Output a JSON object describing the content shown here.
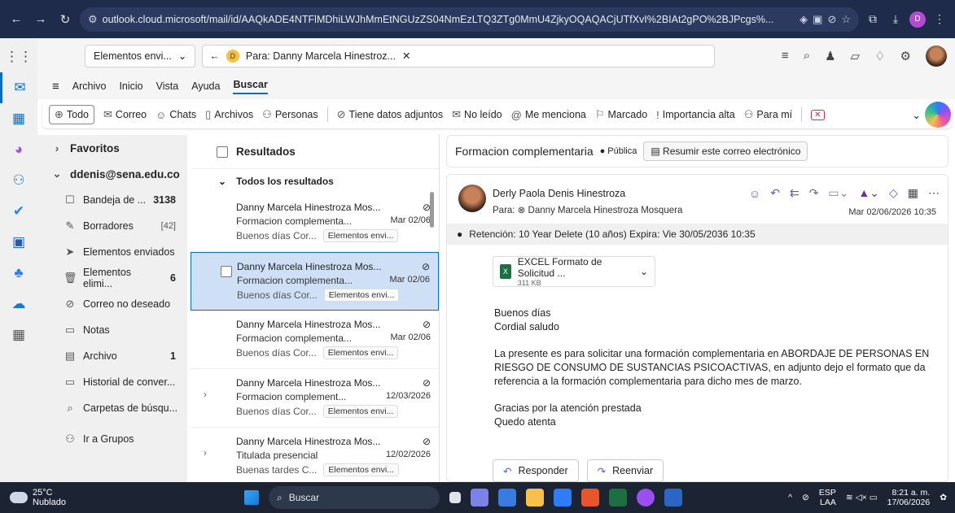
{
  "browser": {
    "url": "outlook.cloud.microsoft/mail/id/AAQkADE4NTFlMDhiLWJhMmEtNGUzZS04NmEzLTQ3ZTg0MmU4ZjkyOQAQACjUTfXvI%2BIAt2gPO%2BJPcgs%...",
    "profile_initial": "D"
  },
  "topbar": {
    "folder_pill": "Elementos envi...",
    "tab_chip_initial": "D",
    "tab_chip_label": "Para: Danny Marcela Hinestroz..."
  },
  "menu": {
    "items": [
      "Archivo",
      "Inicio",
      "Vista",
      "Ayuda"
    ],
    "active": "Buscar"
  },
  "filters": [
    {
      "icon": "⊕",
      "label": "Todo"
    },
    {
      "icon": "✉",
      "label": "Correo"
    },
    {
      "icon": "☺",
      "label": "Chats"
    },
    {
      "icon": "▯",
      "label": "Archivos"
    },
    {
      "icon": "⚇",
      "label": "Personas"
    },
    {
      "icon": "⊘",
      "label": "Tiene datos adjuntos"
    },
    {
      "icon": "✉",
      "label": "No leído"
    },
    {
      "icon": "@",
      "label": "Me menciona"
    },
    {
      "icon": "⚐",
      "label": "Marcado"
    },
    {
      "icon": "!",
      "label": "Importancia alta"
    },
    {
      "icon": "⚇",
      "label": "Para mí"
    }
  ],
  "folders": {
    "favoritos": "Favoritos",
    "account": "ddenis@sena.edu.co",
    "items": [
      {
        "icon": "☐",
        "label": "Bandeja de ...",
        "count": "3138"
      },
      {
        "icon": "✎",
        "label": "Borradores",
        "count": "[42]"
      },
      {
        "icon": "➤",
        "label": "Elementos enviados",
        "count": ""
      },
      {
        "icon": "🗑",
        "label": "Elementos elimi...",
        "count": "6"
      },
      {
        "icon": "⊘",
        "label": "Correo no deseado",
        "count": ""
      },
      {
        "icon": "▭",
        "label": "Notas",
        "count": ""
      },
      {
        "icon": "▤",
        "label": "Archivo",
        "count": "1"
      },
      {
        "icon": "▭",
        "label": "Historial de conver...",
        "count": ""
      },
      {
        "icon": "⌕",
        "label": "Carpetas de búsqu...",
        "count": ""
      }
    ],
    "groups": "Ir a Grupos"
  },
  "list": {
    "header": "Resultados",
    "group": "Todos los resultados",
    "rows": [
      {
        "from": "Danny Marcela Hinestroza Mos...",
        "subject": "Formacion complementa...",
        "date": "Mar 02/06",
        "preview": "Buenos días Cor...",
        "tag": "Elementos envi..."
      },
      {
        "from": "Danny Marcela Hinestroza Mos...",
        "subject": "Formacion complementa...",
        "date": "Mar 02/06",
        "preview": "Buenos días Cor...",
        "tag": "Elementos envi..."
      },
      {
        "from": "Danny Marcela Hinestroza Mos...",
        "subject": "Formacion complementa...",
        "date": "Mar 02/06",
        "preview": "Buenos días Cor...",
        "tag": "Elementos envi..."
      },
      {
        "from": "Danny Marcela Hinestroza Mos...",
        "subject": "Formacion complement...",
        "date": "12/03/2026",
        "preview": "Buenos días Cor...",
        "tag": "Elementos envi..."
      },
      {
        "from": "Danny Marcela Hinestroza Mos...",
        "subject": "Titulada presencial",
        "date": "12/02/2026",
        "preview": "Buenas tardes C...",
        "tag": "Elementos envi..."
      }
    ]
  },
  "reading": {
    "subject": "Formacion complementaria",
    "visibility": "Pública",
    "summarize": "Resumir este correo electrónico",
    "sender": "Derly Paola Denis Hinestroza",
    "to": "Para: ⊗ Danny Marcela Hinestroza Mosquera",
    "date": "Mar 02/06/2026 10:35",
    "retention": "Retención: 10 Year Delete (10 años) Expira: Vie 30/05/2036 10:35",
    "attachment_name": "EXCEL Formato de Solicitud ...",
    "attachment_size": "311 KB",
    "body": [
      "Buenos días",
      "Cordial saludo",
      "La presente es para solicitar una formación complementaria en ABORDAJE DE PERSONAS EN RIESGO DE CONSUMO DE SUSTANCIAS PSICOACTIVAS, en adjunto dejo el formato que da referencia a la formación complementaria para dicho mes de marzo.",
      "Gracias por la atención prestada",
      "Quedo atenta"
    ],
    "reply": "Responder",
    "forward": "Reenviar"
  },
  "taskbar": {
    "temp": "25°C",
    "weather": "Nublado",
    "search": "Buscar",
    "lang1": "ESP",
    "lang2": "LAA",
    "time": "8:21 a. m.",
    "date": "17/06/2026"
  }
}
